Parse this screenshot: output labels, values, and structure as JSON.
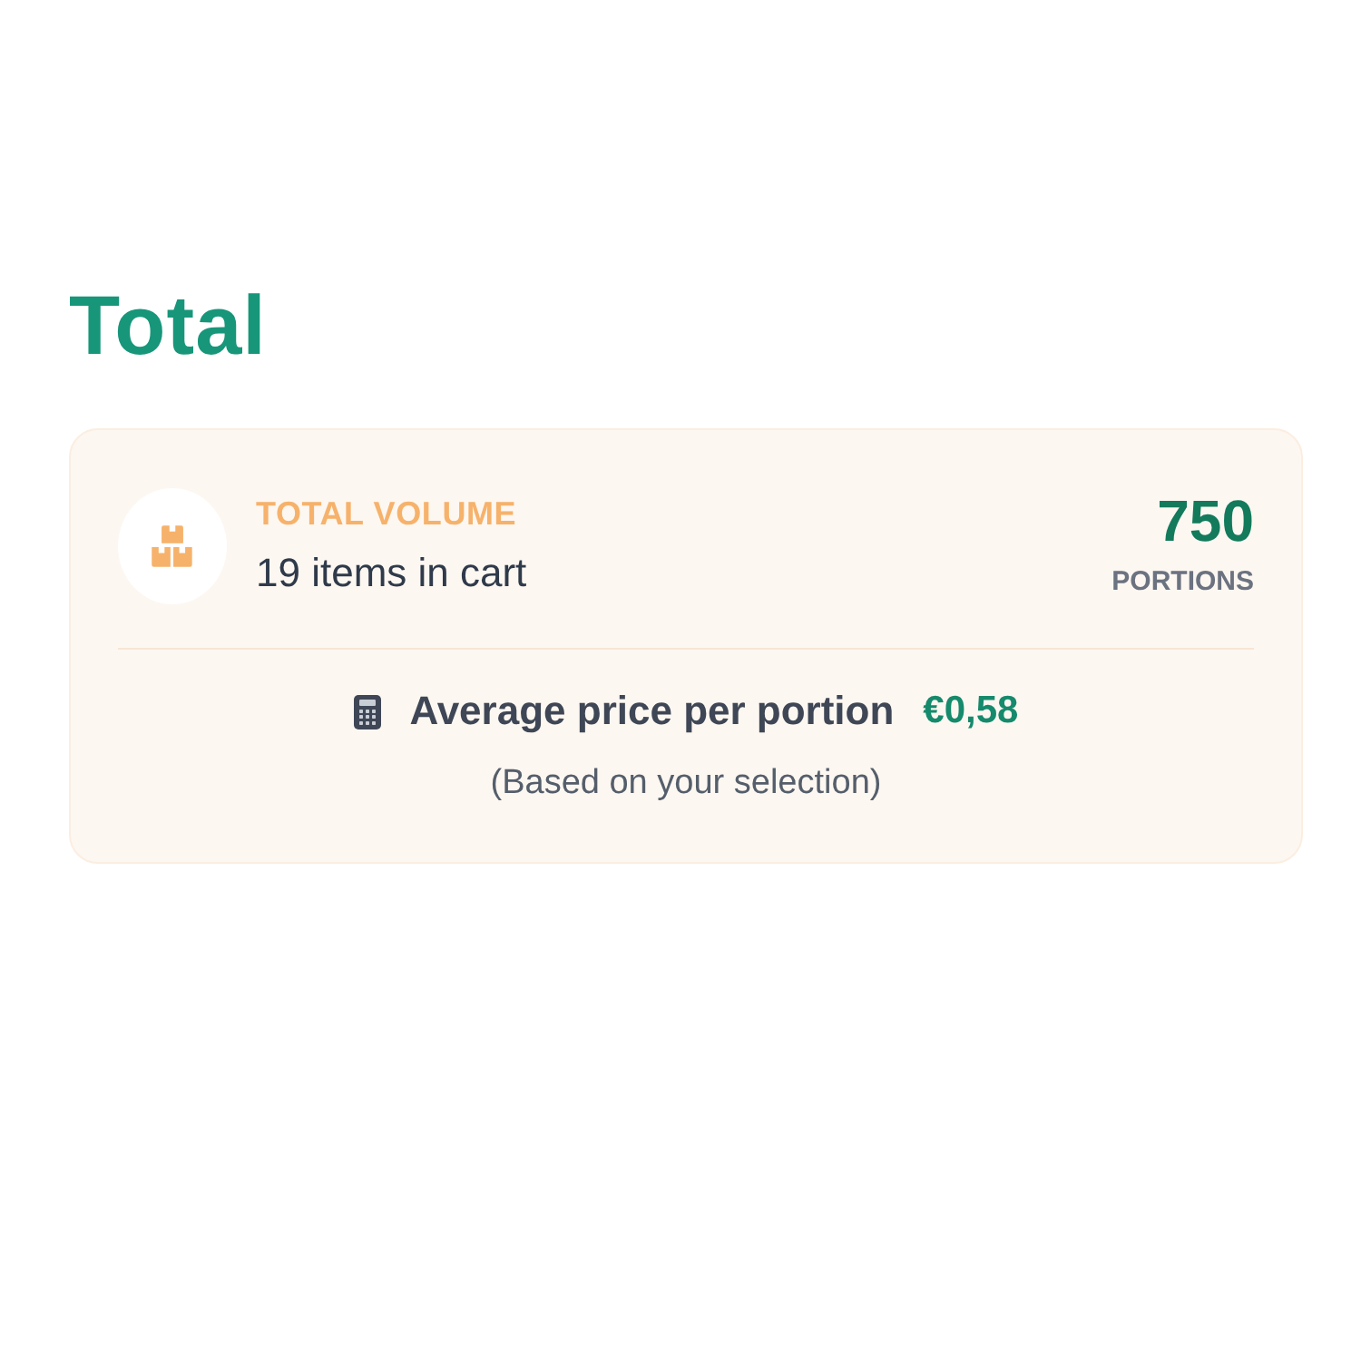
{
  "heading": "Total",
  "summary": {
    "label": "TOTAL VOLUME",
    "items": "19 items in cart",
    "count": "750",
    "count_unit": "PORTIONS"
  },
  "average": {
    "label": "Average price per portion",
    "price": "€0,58",
    "note": "(Based on your selection)"
  }
}
